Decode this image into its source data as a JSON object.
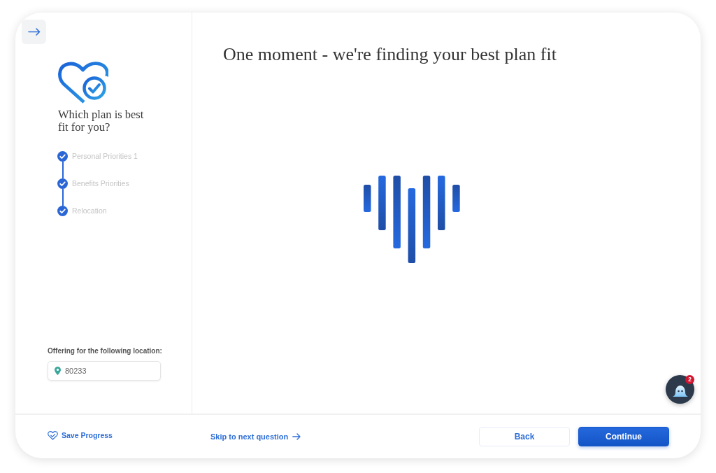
{
  "sidebar": {
    "title": "Which plan is best fit for you?",
    "steps": [
      {
        "label": "Personal Priorities 1",
        "completed": true
      },
      {
        "label": "Benefits Priorities",
        "completed": true
      },
      {
        "label": "Relocation",
        "completed": true
      }
    ],
    "location": {
      "label": "Offering for the following location:",
      "value": "80233"
    }
  },
  "main": {
    "title": "One moment - we're finding your best plan fit"
  },
  "chat_button": {
    "badge": "2"
  },
  "footer": {
    "save_progress": "Save Progress",
    "skip_link": "Skip to next question",
    "buttons": [
      {
        "label": "Back",
        "kind": "secondary"
      },
      {
        "label": "Continue",
        "kind": "primary"
      }
    ]
  }
}
